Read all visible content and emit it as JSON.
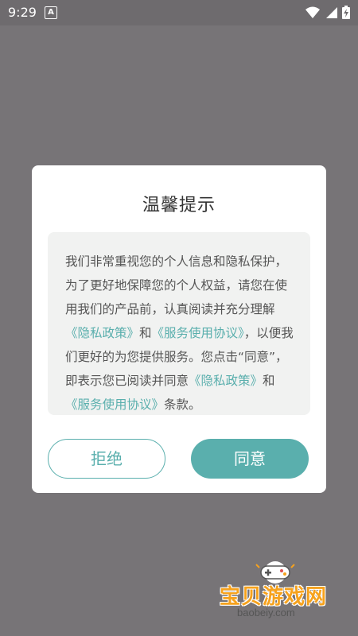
{
  "status_bar": {
    "time": "9:29",
    "notification_icon": "A"
  },
  "dialog": {
    "title": "温馨提示",
    "body": {
      "p1": "我们非常重视您的个人信息和隐私保护，为了更好地保障您的个人权益，请您在使用我们的产品前，认真阅读并充分理解",
      "link_privacy": "《隐私政策》",
      "and1": "和",
      "link_service": "《服务使用协议》",
      "p2": "，以便我们更好的为您提供服务。您点击“同意”，即表示您已阅读并同意",
      "link_privacy2": "《隐私政策》",
      "and2": "和",
      "link_service2": "《服务使用协议》",
      "p3": "条款。"
    },
    "reject_label": "拒绝",
    "agree_label": "同意"
  },
  "watermark": {
    "text": "宝贝游戏网",
    "url": "baobeiy.com"
  },
  "colors": {
    "accent": "#5aafad",
    "overlay": "#777477",
    "watermark": "#f6a21d"
  }
}
